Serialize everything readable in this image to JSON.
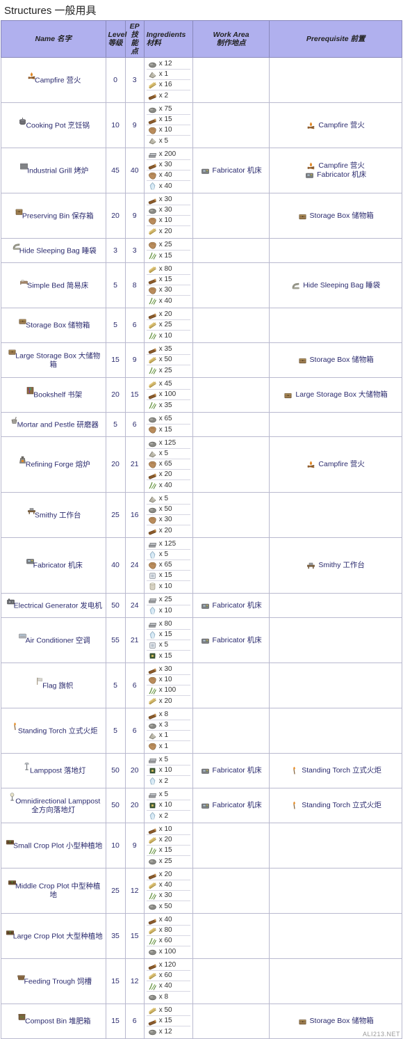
{
  "page": {
    "title": "Structures 一般用具",
    "watermark": "ALI213.NET"
  },
  "columns": [
    {
      "key": "name",
      "label": "Name 名字"
    },
    {
      "key": "level",
      "label": "Level\n等级"
    },
    {
      "key": "ep",
      "label": "EP\n技能点"
    },
    {
      "key": "ingredients",
      "label": "Ingredients\n材料"
    },
    {
      "key": "work_area",
      "label": "Work Area\n制作地点"
    },
    {
      "key": "prerequisite",
      "label": "Prerequisite 前置"
    }
  ],
  "column_labels": {
    "name": "Name 名字",
    "level_l1": "Level",
    "level_l2": "等级",
    "ep_l1": "EP",
    "ep_l2": "技能点",
    "ing_l1": "Ingredients",
    "ing_l2": "材料",
    "area_l1": "Work Area",
    "area_l2": "制作地点",
    "prereq": "Prerequisite 前置"
  },
  "rows": [
    {
      "name": "Campfire 营火",
      "icon": "campfire-icon",
      "level": "0",
      "ep": "3",
      "ingredients": [
        {
          "icon": "stone-icon",
          "qty": "x 12"
        },
        {
          "icon": "flint-icon",
          "qty": "x 1"
        },
        {
          "icon": "thatch-icon",
          "qty": "x 16"
        },
        {
          "icon": "wood-icon",
          "qty": "x 2"
        }
      ],
      "work_area": [],
      "prerequisite": []
    },
    {
      "name": "Cooking Pot 烹饪锅",
      "icon": "cookingpot-icon",
      "level": "10",
      "ep": "9",
      "ingredients": [
        {
          "icon": "stone-icon",
          "qty": "x 75"
        },
        {
          "icon": "wood-icon",
          "qty": "x 15"
        },
        {
          "icon": "hide-icon",
          "qty": "x 10"
        },
        {
          "icon": "flint-icon",
          "qty": "x 5"
        }
      ],
      "work_area": [],
      "prerequisite": [
        {
          "icon": "campfire-icon",
          "label": "Campfire 营火"
        }
      ]
    },
    {
      "name": "Industrial Grill 烤炉",
      "icon": "grill-icon",
      "level": "45",
      "ep": "40",
      "ingredients": [
        {
          "icon": "metal-icon",
          "qty": "x 200"
        },
        {
          "icon": "wood-icon",
          "qty": "x 30"
        },
        {
          "icon": "hide-icon",
          "qty": "x 40"
        },
        {
          "icon": "crystal-icon",
          "qty": "x 40"
        }
      ],
      "work_area": [
        {
          "icon": "fabricator-icon",
          "label": "Fabricator 机床"
        }
      ],
      "prerequisite": [
        {
          "icon": "campfire-icon",
          "label": "Campfire 营火"
        },
        {
          "icon": "fabricator-icon",
          "label": "Fabricator 机床"
        }
      ]
    },
    {
      "name": "Preserving Bin 保存箱",
      "icon": "preservingbin-icon",
      "level": "20",
      "ep": "9",
      "ingredients": [
        {
          "icon": "wood-icon",
          "qty": "x 30"
        },
        {
          "icon": "stone-icon",
          "qty": "x 30"
        },
        {
          "icon": "hide-icon",
          "qty": "x 10"
        },
        {
          "icon": "thatch-icon",
          "qty": "x 20"
        }
      ],
      "work_area": [],
      "prerequisite": [
        {
          "icon": "storagebox-icon",
          "label": "Storage Box 储物箱"
        }
      ]
    },
    {
      "name": "Hide Sleeping Bag 睡袋",
      "icon": "sleepingbag-icon",
      "level": "3",
      "ep": "3",
      "ingredients": [
        {
          "icon": "hide-icon",
          "qty": "x 25"
        },
        {
          "icon": "fiber-icon",
          "qty": "x 15"
        }
      ],
      "work_area": [],
      "prerequisite": []
    },
    {
      "name": "Simple Bed 简易床",
      "icon": "bed-icon",
      "level": "5",
      "ep": "8",
      "ingredients": [
        {
          "icon": "thatch-icon",
          "qty": "x 80"
        },
        {
          "icon": "wood-icon",
          "qty": "x 15"
        },
        {
          "icon": "hide-icon",
          "qty": "x 30"
        },
        {
          "icon": "fiber-icon",
          "qty": "x 40"
        }
      ],
      "work_area": [],
      "prerequisite": [
        {
          "icon": "sleepingbag-icon",
          "label": "Hide Sleeping Bag 睡袋"
        }
      ]
    },
    {
      "name": "Storage Box 储物箱",
      "icon": "storagebox-icon",
      "level": "5",
      "ep": "6",
      "ingredients": [
        {
          "icon": "wood-icon",
          "qty": "x 20"
        },
        {
          "icon": "thatch-icon",
          "qty": "x 25"
        },
        {
          "icon": "fiber-icon",
          "qty": "x 10"
        }
      ],
      "work_area": [],
      "prerequisite": []
    },
    {
      "name": "Large Storage Box 大储物箱",
      "icon": "storagebox-icon",
      "level": "15",
      "ep": "9",
      "ingredients": [
        {
          "icon": "wood-icon",
          "qty": "x 35"
        },
        {
          "icon": "thatch-icon",
          "qty": "x 50"
        },
        {
          "icon": "fiber-icon",
          "qty": "x 25"
        }
      ],
      "work_area": [],
      "prerequisite": [
        {
          "icon": "storagebox-icon",
          "label": "Storage Box 储物箱"
        }
      ]
    },
    {
      "name": "Bookshelf 书架",
      "icon": "bookshelf-icon",
      "level": "20",
      "ep": "15",
      "ingredients": [
        {
          "icon": "thatch-icon",
          "qty": "x 45"
        },
        {
          "icon": "wood-icon",
          "qty": "x 100"
        },
        {
          "icon": "fiber-icon",
          "qty": "x 35"
        }
      ],
      "work_area": [],
      "prerequisite": [
        {
          "icon": "storagebox-icon",
          "label": "Large Storage Box 大储物箱"
        }
      ]
    },
    {
      "name": "Mortar and Pestle 研磨器",
      "icon": "mortar-icon",
      "level": "5",
      "ep": "6",
      "ingredients": [
        {
          "icon": "stone-icon",
          "qty": "x 65"
        },
        {
          "icon": "hide-icon",
          "qty": "x 15"
        }
      ],
      "work_area": [],
      "prerequisite": []
    },
    {
      "name": "Refining Forge 熔炉",
      "icon": "forge-icon",
      "level": "20",
      "ep": "21",
      "ingredients": [
        {
          "icon": "stone-icon",
          "qty": "x 125"
        },
        {
          "icon": "flint-icon",
          "qty": "x 5"
        },
        {
          "icon": "hide-icon",
          "qty": "x 65"
        },
        {
          "icon": "wood-icon",
          "qty": "x 20"
        },
        {
          "icon": "fiber-icon",
          "qty": "x 40"
        }
      ],
      "work_area": [],
      "prerequisite": [
        {
          "icon": "campfire-icon",
          "label": "Campfire 营火"
        }
      ]
    },
    {
      "name": "Smithy 工作台",
      "icon": "smithy-icon",
      "level": "25",
      "ep": "16",
      "ingredients": [
        {
          "icon": "flint-icon",
          "qty": "x 5"
        },
        {
          "icon": "stone-icon",
          "qty": "x 50"
        },
        {
          "icon": "hide-icon",
          "qty": "x 30"
        },
        {
          "icon": "wood-icon",
          "qty": "x 20"
        }
      ],
      "work_area": [],
      "prerequisite": []
    },
    {
      "name": "Fabricator 机床",
      "icon": "fabricator-icon",
      "level": "40",
      "ep": "24",
      "ingredients": [
        {
          "icon": "metal-icon",
          "qty": "x 125"
        },
        {
          "icon": "crystal-icon",
          "qty": "x 5"
        },
        {
          "icon": "hide-icon",
          "qty": "x 65"
        },
        {
          "icon": "polymer-icon",
          "qty": "x 15"
        },
        {
          "icon": "cementingpaste-icon",
          "qty": "x 10"
        }
      ],
      "work_area": [],
      "prerequisite": [
        {
          "icon": "smithy-icon",
          "label": "Smithy 工作台"
        }
      ]
    },
    {
      "name": "Electrical Generator 发电机",
      "icon": "generator-icon",
      "level": "50",
      "ep": "24",
      "ingredients": [
        {
          "icon": "metal-icon",
          "qty": "x 25"
        },
        {
          "icon": "crystal-icon",
          "qty": "x 10"
        }
      ],
      "work_area": [
        {
          "icon": "fabricator-icon",
          "label": "Fabricator 机床"
        }
      ],
      "prerequisite": []
    },
    {
      "name": "Air Conditioner 空调",
      "icon": "airconditioner-icon",
      "level": "55",
      "ep": "21",
      "ingredients": [
        {
          "icon": "metal-icon",
          "qty": "x 80"
        },
        {
          "icon": "crystal-icon",
          "qty": "x 15"
        },
        {
          "icon": "polymer-icon",
          "qty": "x 5"
        },
        {
          "icon": "electronics-icon",
          "qty": "x 15"
        }
      ],
      "work_area": [
        {
          "icon": "fabricator-icon",
          "label": "Fabricator 机床"
        }
      ],
      "prerequisite": []
    },
    {
      "name": "Flag 旗帜",
      "icon": "flag-icon",
      "level": "5",
      "ep": "6",
      "ingredients": [
        {
          "icon": "wood-icon",
          "qty": "x 30"
        },
        {
          "icon": "hide-icon",
          "qty": "x 10"
        },
        {
          "icon": "fiber-icon",
          "qty": "x 100"
        },
        {
          "icon": "thatch-icon",
          "qty": "x 20"
        }
      ],
      "work_area": [],
      "prerequisite": []
    },
    {
      "name": "Standing Torch 立式火炬",
      "icon": "torch-icon",
      "level": "5",
      "ep": "6",
      "ingredients": [
        {
          "icon": "wood-icon",
          "qty": "x 8"
        },
        {
          "icon": "stone-icon",
          "qty": "x 3"
        },
        {
          "icon": "flint-icon",
          "qty": "x 1"
        },
        {
          "icon": "hide-icon",
          "qty": "x 1"
        }
      ],
      "work_area": [],
      "prerequisite": []
    },
    {
      "name": "Lamppost 落地灯",
      "icon": "lamppost-icon",
      "level": "50",
      "ep": "20",
      "ingredients": [
        {
          "icon": "metal-icon",
          "qty": "x 5"
        },
        {
          "icon": "electronics-icon",
          "qty": "x 10"
        },
        {
          "icon": "crystal-icon",
          "qty": "x 2"
        }
      ],
      "work_area": [
        {
          "icon": "fabricator-icon",
          "label": "Fabricator 机床"
        }
      ],
      "prerequisite": [
        {
          "icon": "torch-icon",
          "label": "Standing Torch 立式火炬"
        }
      ]
    },
    {
      "name": "Omnidirectional Lamppost 全方向落地灯",
      "icon": "omnilamp-icon",
      "level": "50",
      "ep": "20",
      "ingredients": [
        {
          "icon": "metal-icon",
          "qty": "x 5"
        },
        {
          "icon": "electronics-icon",
          "qty": "x 10"
        },
        {
          "icon": "crystal-icon",
          "qty": "x 2"
        }
      ],
      "work_area": [
        {
          "icon": "fabricator-icon",
          "label": "Fabricator 机床"
        }
      ],
      "prerequisite": [
        {
          "icon": "torch-icon",
          "label": "Standing Torch 立式火炬"
        }
      ]
    },
    {
      "name": "Small Crop Plot 小型种植地",
      "icon": "cropplot-icon",
      "level": "10",
      "ep": "9",
      "ingredients": [
        {
          "icon": "wood-icon",
          "qty": "x 10"
        },
        {
          "icon": "thatch-icon",
          "qty": "x 20"
        },
        {
          "icon": "fiber-icon",
          "qty": "x 15"
        },
        {
          "icon": "stone-icon",
          "qty": "x 25"
        }
      ],
      "work_area": [],
      "prerequisite": []
    },
    {
      "name": "Middle Crop Plot 中型种植地",
      "icon": "cropplot-icon",
      "level": "25",
      "ep": "12",
      "ingredients": [
        {
          "icon": "wood-icon",
          "qty": "x 20"
        },
        {
          "icon": "thatch-icon",
          "qty": "x 40"
        },
        {
          "icon": "fiber-icon",
          "qty": "x 30"
        },
        {
          "icon": "stone-icon",
          "qty": "x 50"
        }
      ],
      "work_area": [],
      "prerequisite": []
    },
    {
      "name": "Large Crop Plot 大型种植地",
      "icon": "cropplot-icon",
      "level": "35",
      "ep": "15",
      "ingredients": [
        {
          "icon": "wood-icon",
          "qty": "x 40"
        },
        {
          "icon": "thatch-icon",
          "qty": "x 80"
        },
        {
          "icon": "fiber-icon",
          "qty": "x 60"
        },
        {
          "icon": "stone-icon",
          "qty": "x 100"
        }
      ],
      "work_area": [],
      "prerequisite": []
    },
    {
      "name": "Feeding Trough 饲槽",
      "icon": "trough-icon",
      "level": "15",
      "ep": "12",
      "ingredients": [
        {
          "icon": "wood-icon",
          "qty": "x 120"
        },
        {
          "icon": "thatch-icon",
          "qty": "x 60"
        },
        {
          "icon": "fiber-icon",
          "qty": "x 40"
        },
        {
          "icon": "stone-icon",
          "qty": "x 8"
        }
      ],
      "work_area": [],
      "prerequisite": []
    },
    {
      "name": "Compost Bin 堆肥箱",
      "icon": "compostbin-icon",
      "level": "15",
      "ep": "6",
      "ingredients": [
        {
          "icon": "thatch-icon",
          "qty": "x 50"
        },
        {
          "icon": "wood-icon",
          "qty": "x 15"
        },
        {
          "icon": "stone-icon",
          "qty": "x 12"
        }
      ],
      "work_area": [],
      "prerequisite": [
        {
          "icon": "storagebox-icon",
          "label": "Storage Box 储物箱"
        }
      ]
    }
  ],
  "colors": {
    "header_bg": "#b0b0ee",
    "border": "#b9b9cf",
    "text": "#2b2b6e"
  }
}
